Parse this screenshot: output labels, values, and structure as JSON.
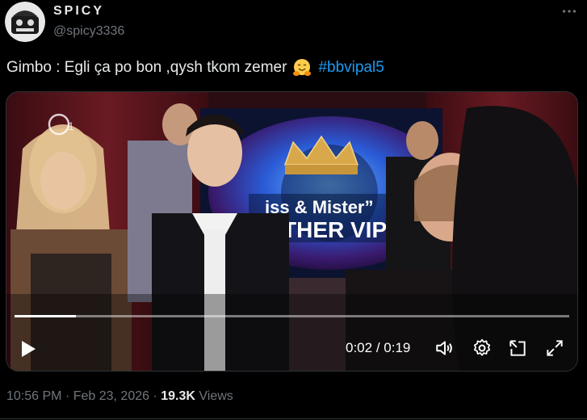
{
  "author": {
    "display_name": "SPICY",
    "handle": "@spicy3336"
  },
  "menu": {
    "icon": "more-horizontal-icon"
  },
  "tweet": {
    "text": "Gimbo : Egli ça po bon ,qysh tkom zemer",
    "emoji": "hugging-face-emoji",
    "hashtag": "#bbvipal5"
  },
  "video": {
    "progress_fraction": 0.11,
    "current_time": "0:02",
    "separator": "/",
    "duration": "0:19",
    "background_sign_text": "iss & Mister”\nROTHER VIP",
    "controls": {
      "play": "play-icon",
      "volume": "volume-icon",
      "settings": "gear-icon",
      "pip": "picture-in-picture-icon",
      "fullscreen": "fullscreen-icon"
    }
  },
  "footer": {
    "time": "10:56 PM",
    "dot": "·",
    "date": "Feb 23, 2026",
    "views_count": "19.3K",
    "views_label": "Views"
  },
  "colors": {
    "background": "#000000",
    "text": "#e7e9ea",
    "secondary": "#71767b",
    "hashtag": "#1d9bf0",
    "border": "#2f3336"
  }
}
